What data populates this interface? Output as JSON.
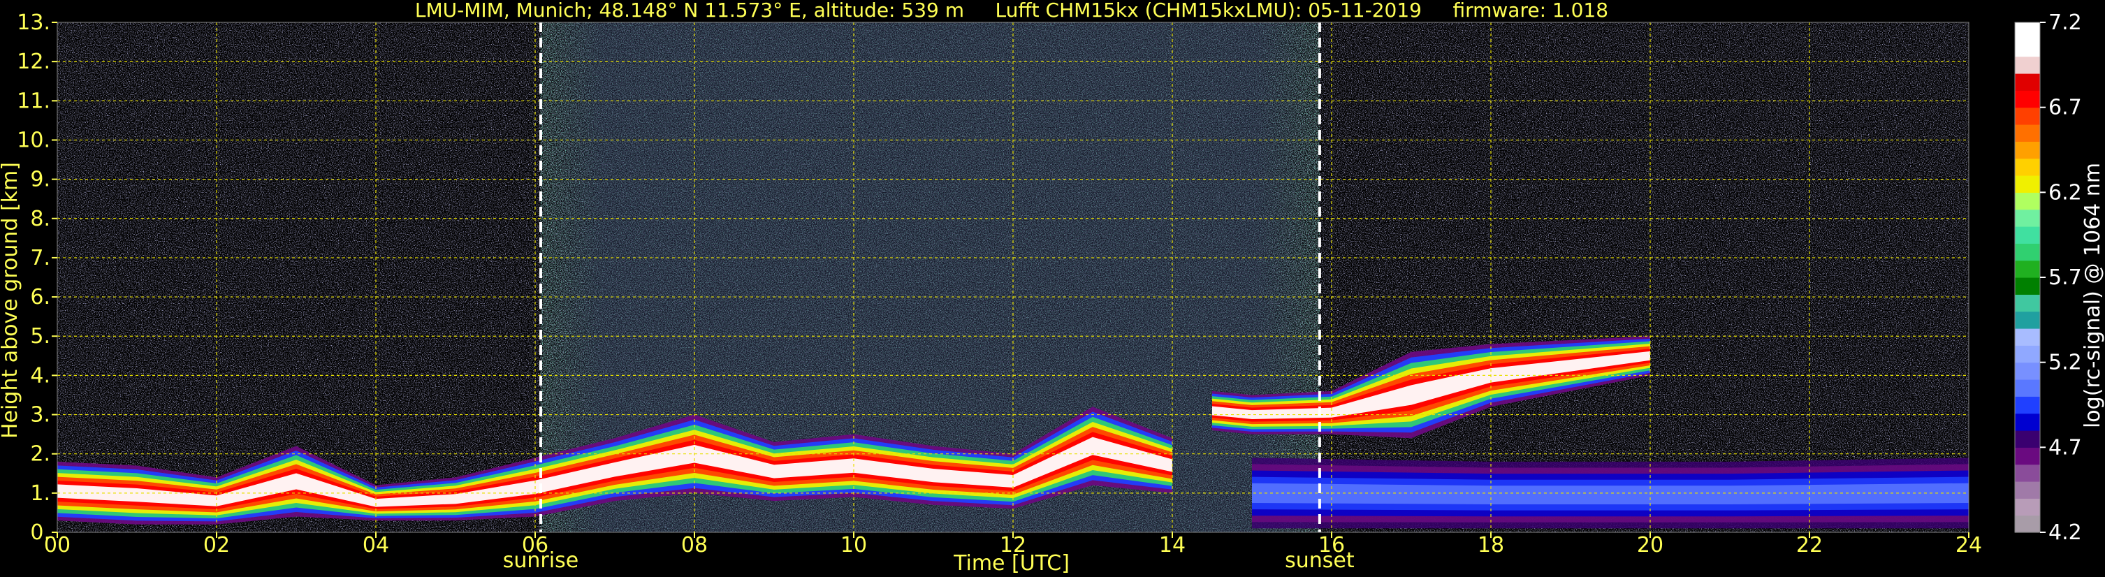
{
  "chart_data": {
    "type": "heatmap",
    "title": "LMU-MIM, Munich; 48.148° N 11.573° E, altitude: 539 m     Lufft CHM15kx (CHM15kxLMU): 05-11-2019     firmware: 1.018",
    "xlabel": "Time [UTC]",
    "ylabel": "Height above ground [km]",
    "xlim": [
      0,
      24
    ],
    "ylim": [
      0,
      13
    ],
    "x_ticks": [
      "00",
      "02",
      "04",
      "06",
      "08",
      "10",
      "12",
      "14",
      "16",
      "18",
      "20",
      "22",
      "24"
    ],
    "x_tick_values": [
      0,
      2,
      4,
      6,
      8,
      10,
      12,
      14,
      16,
      18,
      20,
      22,
      24
    ],
    "y_ticks": [
      "0.",
      "1.",
      "2.",
      "3.",
      "4.",
      "5.",
      "6.",
      "7.",
      "8.",
      "9.",
      "10.",
      "11.",
      "12.",
      "13."
    ],
    "y_tick_values": [
      0,
      1,
      2,
      3,
      4,
      5,
      6,
      7,
      8,
      9,
      10,
      11,
      12,
      13
    ],
    "grid": true,
    "background": "#000000",
    "events": [
      {
        "label": "sunrise",
        "time": 6.07
      },
      {
        "label": "sunset",
        "time": 15.85
      }
    ],
    "colorbar": {
      "label": "log(rc-signal) @ 1064 nm",
      "range": [
        4.2,
        7.2
      ],
      "ticks": [
        "7.2",
        "6.7",
        "6.2",
        "5.7",
        "5.2",
        "4.7",
        "4.2"
      ],
      "tick_values": [
        7.2,
        6.7,
        6.2,
        5.7,
        5.2,
        4.7,
        4.2
      ],
      "colors": [
        "#a89ca8",
        "#b89cb8",
        "#a07aa8",
        "#8a4c9a",
        "#6a0a80",
        "#3a0070",
        "#0000d0",
        "#2040ff",
        "#5a78ff",
        "#7890ff",
        "#90a8ff",
        "#a8bcff",
        "#20a0a0",
        "#40c8a0",
        "#008000",
        "#20b020",
        "#30d070",
        "#40e0a0",
        "#70f0a0",
        "#b0ff60",
        "#f0f000",
        "#ffd000",
        "#ffa000",
        "#ff7000",
        "#ff4000",
        "#ff0000",
        "#e00000",
        "#f0d0d0",
        "#ffffff",
        "#ffffff"
      ]
    },
    "features": [
      {
        "name": "boundary-layer-aerosol",
        "x": [
          0,
          1,
          2,
          3,
          4,
          5,
          6,
          7,
          8,
          9,
          10,
          11,
          12,
          13,
          14
        ],
        "y_top": [
          1.8,
          1.7,
          1.4,
          2.2,
          1.2,
          1.4,
          1.9,
          2.4,
          3.0,
          2.3,
          2.5,
          2.2,
          2.0,
          3.2,
          2.4
        ],
        "y_bottom": [
          0.3,
          0.2,
          0.2,
          0.4,
          0.3,
          0.3,
          0.4,
          0.8,
          1.0,
          0.8,
          0.9,
          0.7,
          0.6,
          1.2,
          1.0
        ]
      },
      {
        "name": "evening-cloud-layer",
        "x": [
          14.5,
          15.0,
          16.0,
          17.0,
          18.0,
          19.0,
          20.0
        ],
        "y_top": [
          3.6,
          3.5,
          3.6,
          4.6,
          4.8,
          4.9,
          5.0
        ],
        "y_bottom": [
          2.6,
          2.5,
          2.5,
          2.4,
          3.2,
          3.6,
          4.0
        ]
      },
      {
        "name": "nocturnal-layer",
        "x": [
          15.0,
          18.0,
          21.0,
          24.0
        ],
        "y_top": [
          1.9,
          1.8,
          1.8,
          1.9
        ],
        "y_bottom": [
          0.1,
          0.1,
          0.1,
          0.1
        ]
      }
    ]
  }
}
